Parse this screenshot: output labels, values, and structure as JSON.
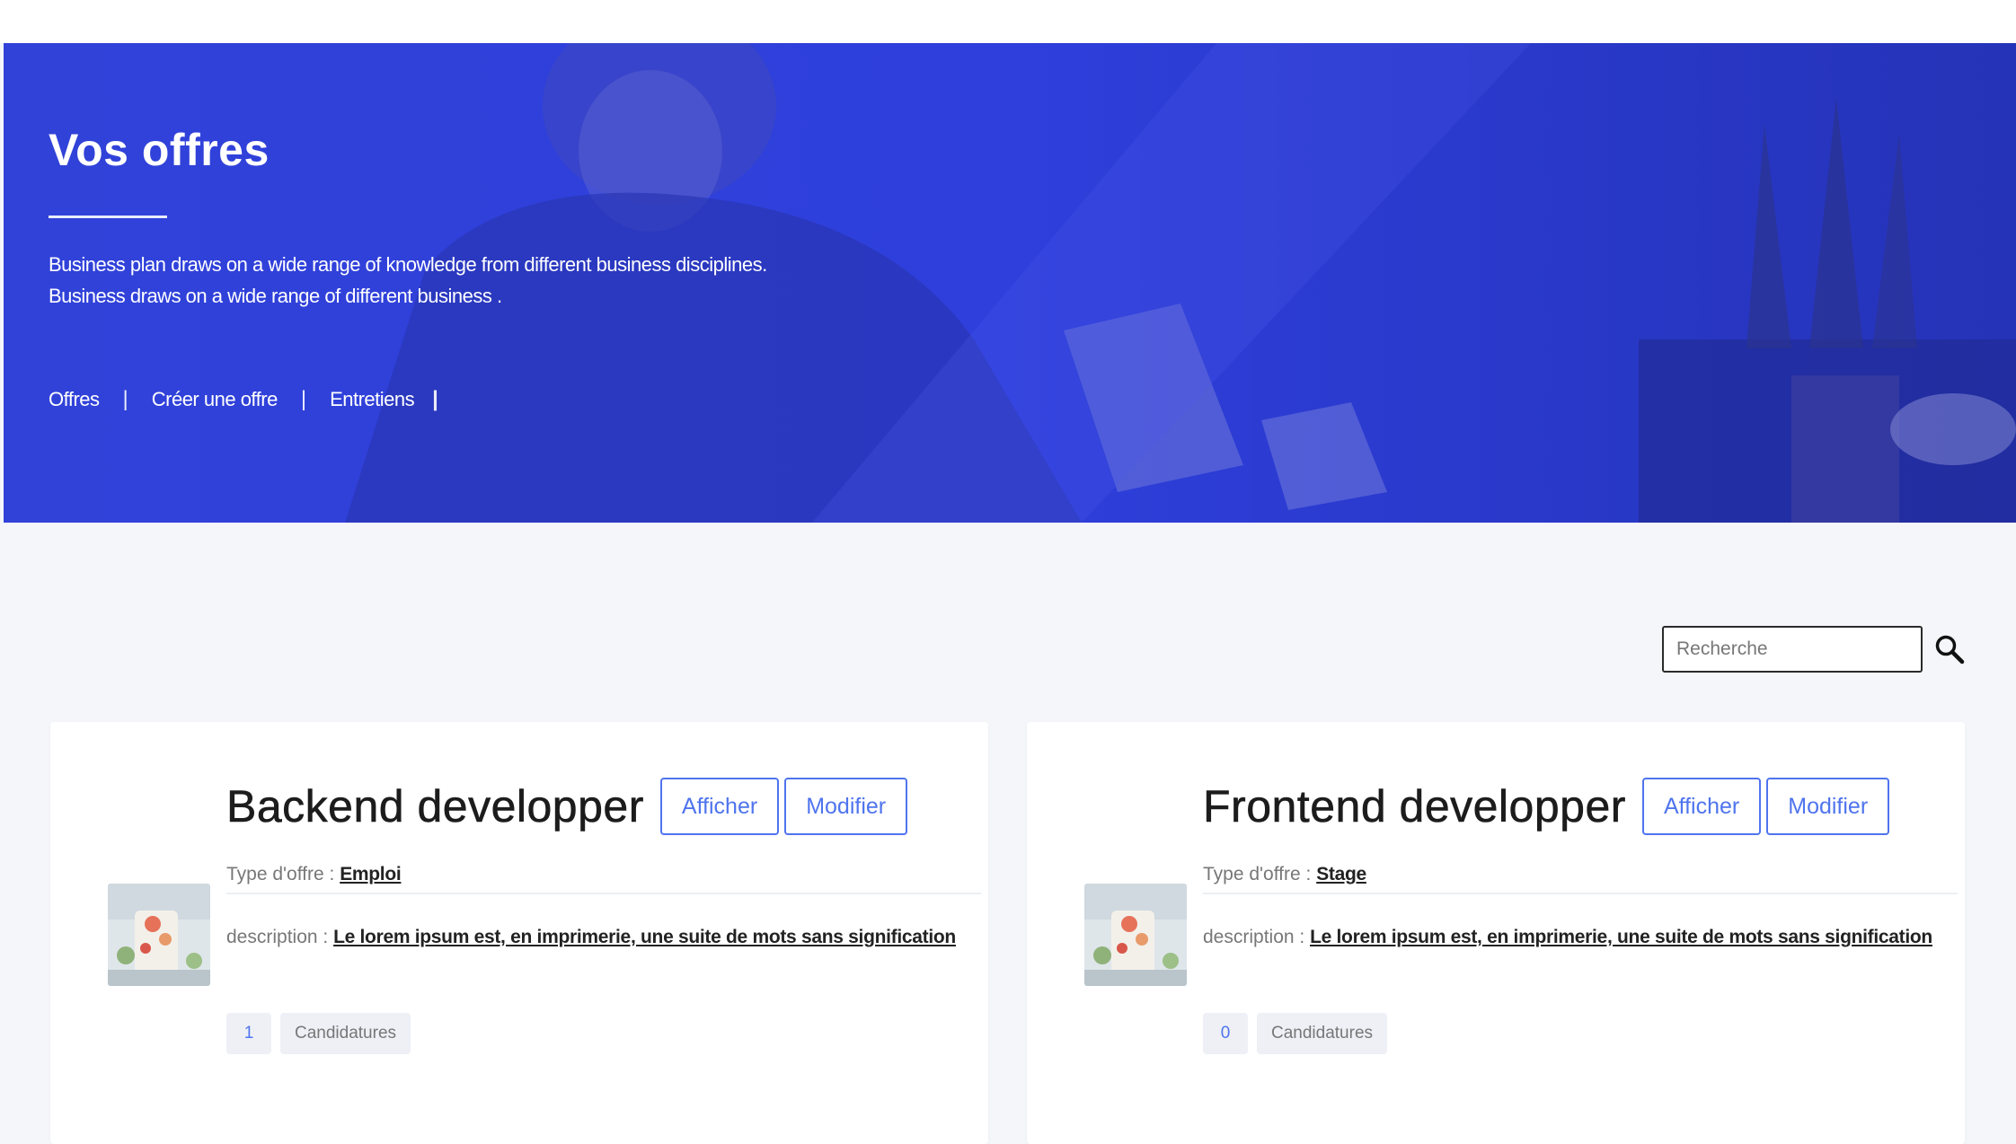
{
  "hero": {
    "title": "Vos offres",
    "description": "Business plan draws on a wide range of knowledge from different business disciplines. Business draws on a wide range of different business .",
    "nav": [
      {
        "label": "Offres"
      },
      {
        "label": "Créer une offre"
      },
      {
        "label": "Entretiens"
      }
    ],
    "separator": "|",
    "background_color": "#2d3fd8"
  },
  "search": {
    "placeholder": "Recherche",
    "icon": "search-icon"
  },
  "offers": [
    {
      "title": "Backend developper",
      "view_label": "Afficher",
      "edit_label": "Modifier",
      "type_label": "Type d'offre : ",
      "type_value": "Emploi",
      "description_label": "description : ",
      "description_value": "Le lorem ipsum est, en imprimerie, une suite de mots sans signification",
      "applications_count": "1",
      "applications_label": "Candidatures"
    },
    {
      "title": "Frontend developper",
      "view_label": "Afficher",
      "edit_label": "Modifier",
      "type_label": "Type d'offre : ",
      "type_value": "Stage",
      "description_label": "description : ",
      "description_value": "Le lorem ipsum est, en imprimerie, une suite de mots sans signification",
      "applications_count": "0",
      "applications_label": "Candidatures"
    }
  ],
  "colors": {
    "accent": "#4f74ee",
    "page_background": "#f4f6fa",
    "card_background": "#ffffff"
  }
}
